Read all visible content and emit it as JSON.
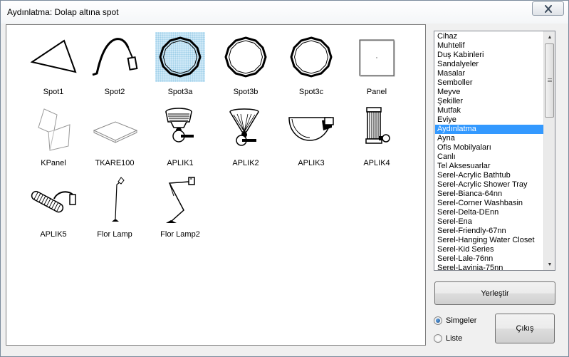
{
  "window": {
    "title": "Aydınlatma:  Dolap altına spot"
  },
  "icons": [
    {
      "label": "Spot1",
      "icon": "spot-triangle-icon"
    },
    {
      "label": "Spot2",
      "icon": "spot-gooseneck-icon"
    },
    {
      "label": "Spot3a",
      "icon": "spot-dodecagon-icon",
      "selected": true
    },
    {
      "label": "Spot3b",
      "icon": "spot-dodecagon-icon"
    },
    {
      "label": "Spot3c",
      "icon": "spot-dodecagon-icon"
    },
    {
      "label": "Panel",
      "icon": "panel-square-icon"
    },
    {
      "label": "KPanel",
      "icon": "kpanel-folded-icon"
    },
    {
      "label": "TKARE100",
      "icon": "square-tile-icon"
    },
    {
      "label": "APLIK1",
      "icon": "wall-lamp-1-icon"
    },
    {
      "label": "APLIK2",
      "icon": "wall-lamp-2-icon"
    },
    {
      "label": "APLIK3",
      "icon": "wall-lamp-3-icon"
    },
    {
      "label": "APLIK4",
      "icon": "wall-lamp-4-icon"
    },
    {
      "label": "APLIK5",
      "icon": "wall-lamp-5-icon"
    },
    {
      "label": "Flor Lamp",
      "icon": "floor-lamp-icon"
    },
    {
      "label": "Flor Lamp2",
      "icon": "floor-lamp-arm-icon"
    }
  ],
  "categories": [
    "Cihaz",
    "Muhtelif",
    "Duş Kabinleri",
    "Sandalyeler",
    "Masalar",
    "Semboller",
    "Meyve",
    "Şekiller",
    "Mutfak",
    "Eviye",
    "Aydınlatma",
    "Ayna",
    "Ofis Mobilyaları",
    "Canlı",
    "Tel Aksesuarlar",
    "Serel-Acrylic Bathtub",
    "Serel-Acrylic Shower Tray",
    "Serel-Bianca-64nn",
    "Serel-Corner Washbasin",
    "Serel-Delta-DEnn",
    "Serel-Ena",
    "Serel-Friendly-67nn",
    "Serel-Hanging Water Closet",
    "Serel-Kid Series",
    "Serel-Lale-76nn",
    "Serel-Lavinia-75nn"
  ],
  "selected_category": "Aydınlatma",
  "buttons": {
    "place": "Yerleştir",
    "exit": "Çıkış"
  },
  "view_mode": {
    "options": [
      "Simgeler",
      "Liste"
    ],
    "selected": "Simgeler"
  },
  "colors": {
    "selection": "#3399ff",
    "icon_selection": "#cfe9f7"
  }
}
